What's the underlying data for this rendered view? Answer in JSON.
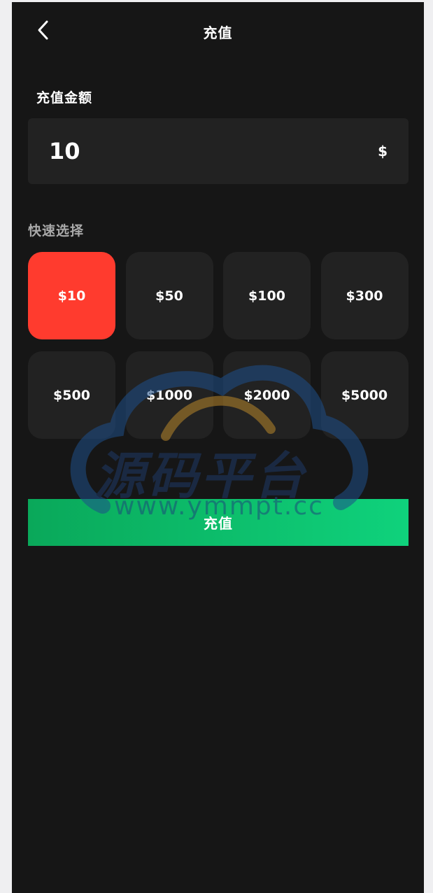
{
  "header": {
    "title": "充值",
    "back_icon": "chevron-left-icon"
  },
  "amount_section": {
    "label": "充值金额",
    "value": "10",
    "currency": "$"
  },
  "quick_section": {
    "label": "快速选择",
    "options": [
      "$10",
      "$50",
      "$100",
      "$300",
      "$500",
      "$1000",
      "$2000",
      "$5000"
    ],
    "selected_index": 0
  },
  "submit": {
    "label": "充值"
  },
  "watermark": {
    "text": "源码平台",
    "url": "www.ymmpt.cc"
  },
  "colors": {
    "background": "#161616",
    "card": "#222222",
    "selected": "#ff3b2e",
    "button_start": "#0aa85a",
    "button_end": "#0fd27c"
  }
}
